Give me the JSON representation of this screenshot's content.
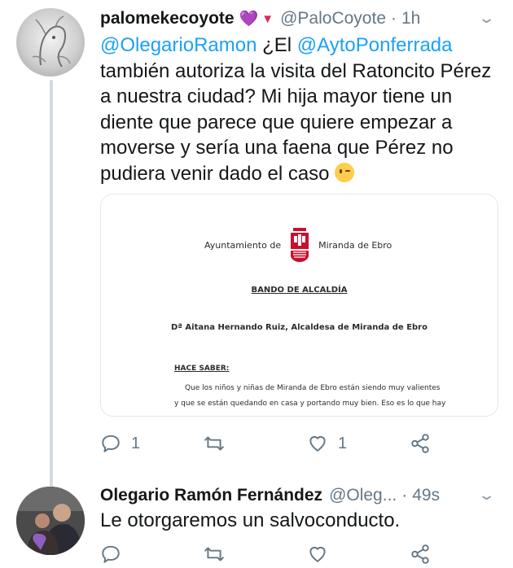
{
  "tweets": [
    {
      "name": "palomekecoyote",
      "handle": "@PaloCoyote",
      "separator": "·",
      "time": "1h",
      "emoji_purple_heart": "💜",
      "emoji_triangle": "▼",
      "text": {
        "mention1": "@OlegarioRamon",
        "t1": " ¿El ",
        "mention2": "@AytoPonferrada",
        "t2": " también autoriza la visita del Ratoncito Pérez a nuestra ciudad? Mi hija mayor tiene un diente que parece que quiere empezar a moverse y sería una faena que Pérez no pudiera venir dado el caso "
      },
      "document": {
        "org_left": "Ayuntamiento de",
        "org_right": "Miranda de Ebro",
        "title": "BANDO DE ALCALDÍA",
        "signer": "Dª Aitana Hernando Ruiz, Alcaldesa de Miranda de Ebro",
        "heading": "HACE SABER:",
        "line1": "Que los niños y niñas de Miranda de Ebro están siendo muy valientes",
        "line2": "y que se están quedando en casa y portando muy bien. Eso es lo que hay"
      },
      "actions": {
        "replies": "1",
        "retweets": "",
        "likes": "1"
      }
    },
    {
      "name": "Olegario Ramón Fernández",
      "handle": "@Oleg...",
      "separator": "·",
      "time": "49s",
      "text": "Le otorgaremos un salvoconducto.",
      "actions": {
        "replies": "",
        "retweets": "",
        "likes": ""
      }
    }
  ],
  "icons": {
    "reply": "reply-icon",
    "retweet": "retweet-icon",
    "like": "heart-icon",
    "share": "share-icon",
    "more": "chevron-down-icon"
  },
  "colors": {
    "link": "#1da1f2",
    "muted": "#657786",
    "thread": "#d3dae0",
    "emblem_red": "#c8102e"
  }
}
